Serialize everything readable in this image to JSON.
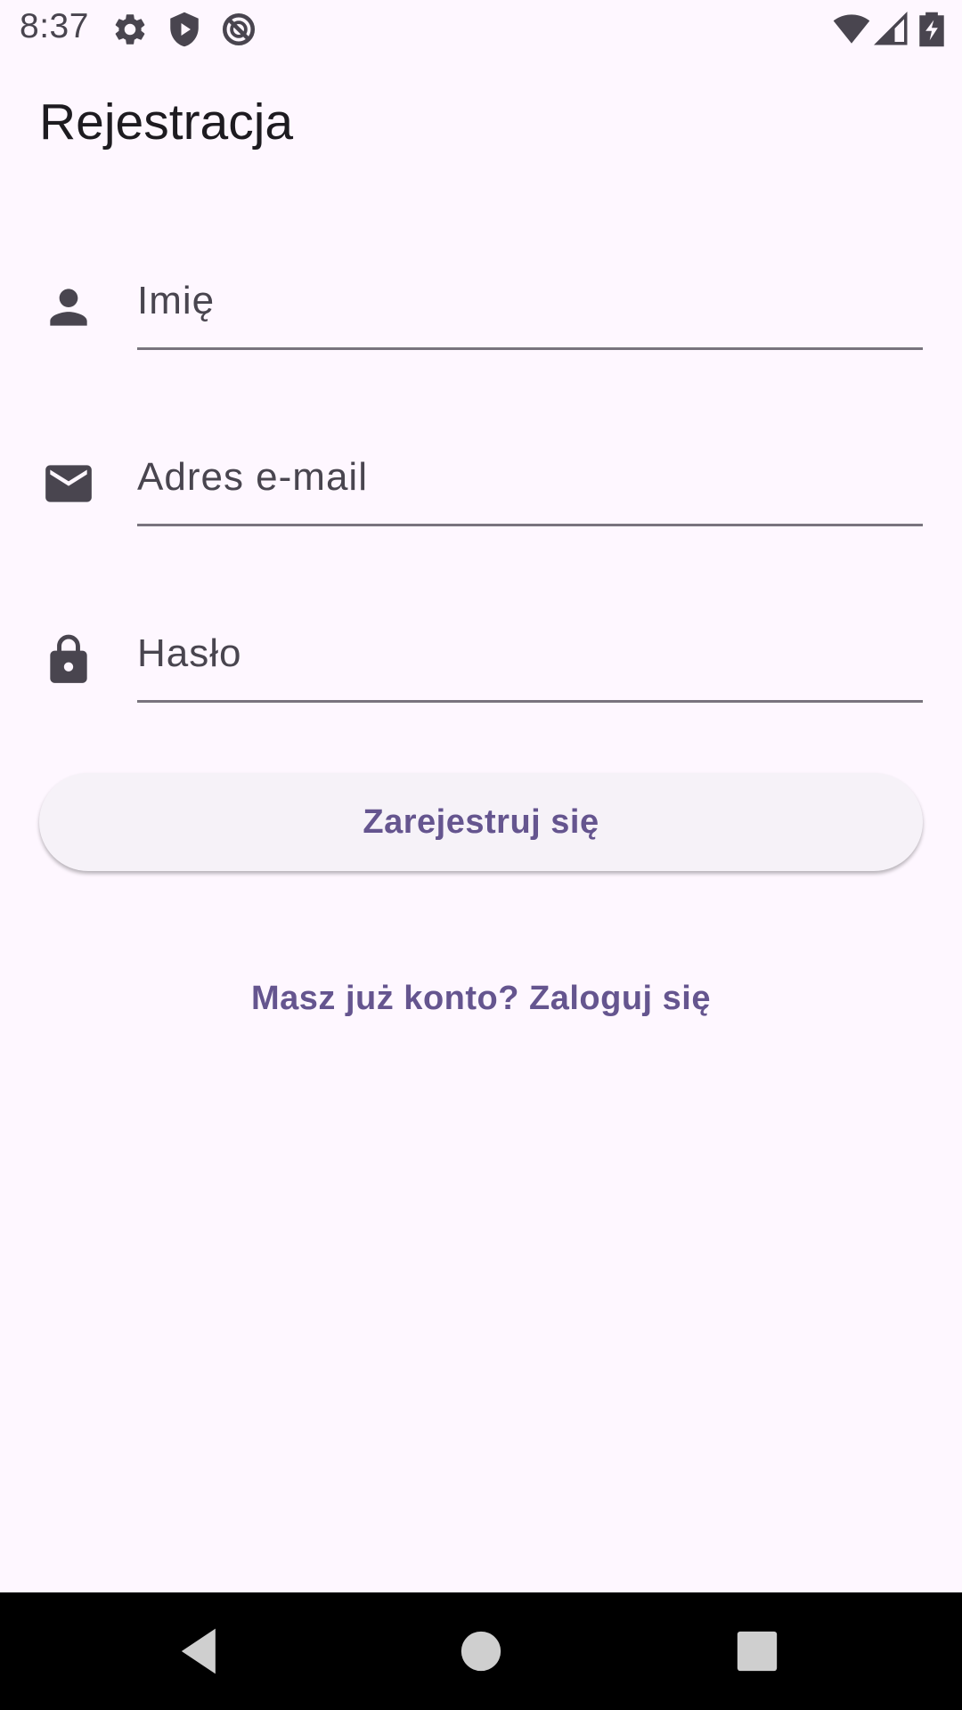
{
  "status_bar": {
    "time": "8:37",
    "icons_left": [
      "gear-icon",
      "play-protect-icon",
      "do-not-disturb-icon"
    ],
    "icons_right": [
      "wifi-icon",
      "cell-signal-icon",
      "battery-charging-icon"
    ]
  },
  "app_bar": {
    "title": "Rejestracja"
  },
  "form": {
    "name_field": {
      "placeholder": "Imię",
      "value": "",
      "icon": "person-icon"
    },
    "email_field": {
      "placeholder": "Adres e-mail",
      "value": "",
      "icon": "mail-icon"
    },
    "password_field": {
      "placeholder": "Hasło",
      "value": "",
      "icon": "lock-icon"
    },
    "register_label": "Zarejestruj się"
  },
  "login_link": "Masz już konto? Zaloguj się",
  "nav_bar": {
    "buttons": [
      "back-icon",
      "home-icon",
      "recents-icon"
    ]
  },
  "colors": {
    "background": "#fef7ff",
    "accent": "#65558f",
    "icon": "#49454f",
    "underline": "#79747e",
    "nav_background": "#000000"
  }
}
